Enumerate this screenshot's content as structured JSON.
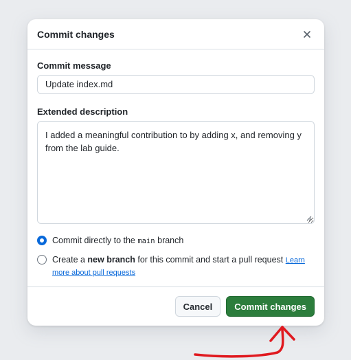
{
  "dialog": {
    "title": "Commit changes",
    "close_icon": "close-icon",
    "commit_message": {
      "label": "Commit message",
      "value": "Update index.md"
    },
    "extended_description": {
      "label": "Extended description",
      "value": "I added a meaningful contribution to by adding x, and removing y from the lab guide."
    },
    "branch_options": [
      {
        "selected": true,
        "text_before": "Commit directly to the ",
        "code": "main",
        "text_after": " branch"
      },
      {
        "selected": false,
        "text_before": "Create a ",
        "bold": "new branch",
        "text_after": " for this commit and start a pull request ",
        "link": "Learn more about pull requests"
      }
    ],
    "buttons": {
      "cancel": "Cancel",
      "commit": "Commit changes"
    }
  },
  "colors": {
    "commit_button": "#2c7d3c",
    "radio_accent": "#0969da",
    "link": "#0969da",
    "annotation_arrow": "#e0191f"
  }
}
